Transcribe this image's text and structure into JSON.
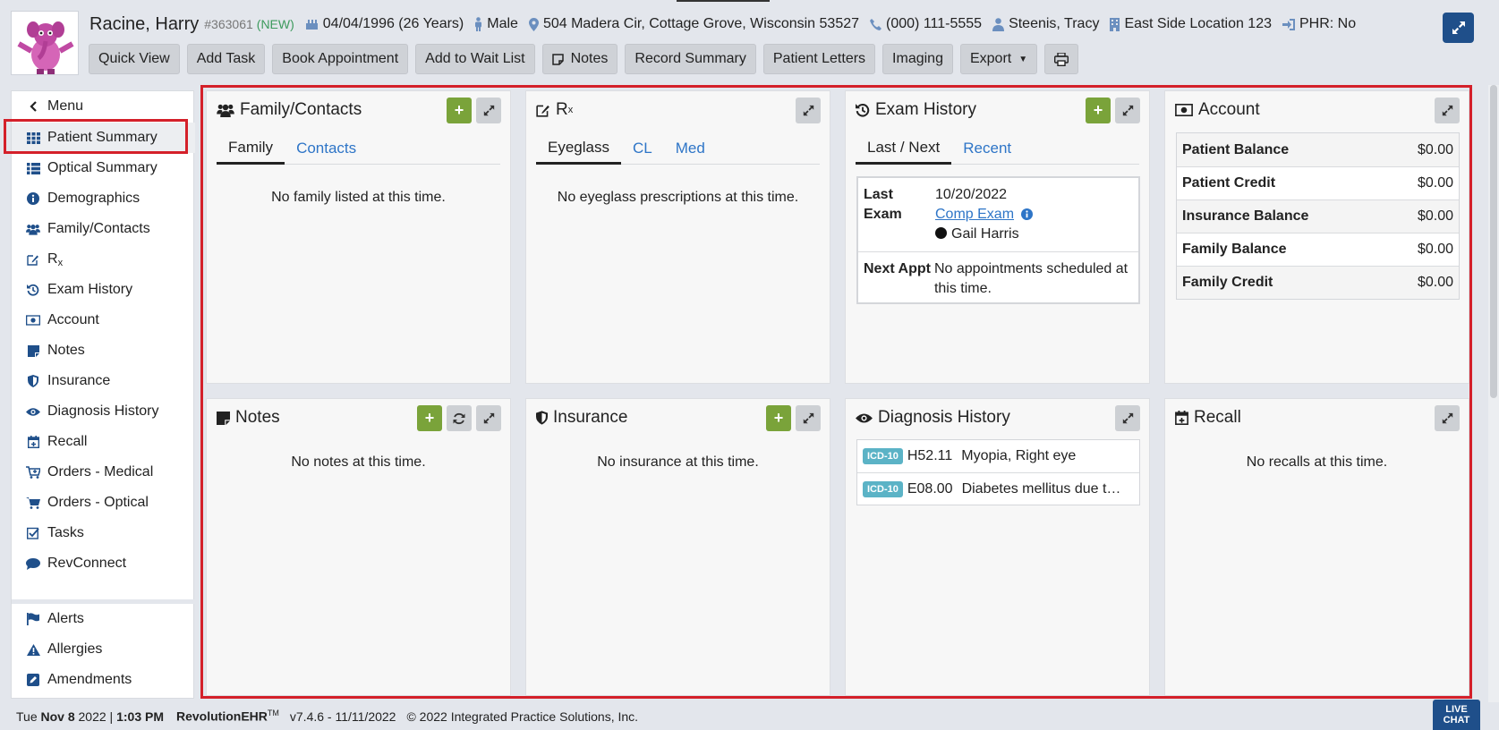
{
  "patient": {
    "name": "Racine, Harry",
    "id": "#363061",
    "status": "(NEW)",
    "dob": "04/04/1996 (26 Years)",
    "gender": "Male",
    "address": "504 Madera Cir, Cottage Grove, Wisconsin 53527",
    "phone": "(000) 111-5555",
    "provider": "Steenis, Tracy",
    "location": "East Side Location 123",
    "phr": "PHR: No"
  },
  "toolbar": {
    "quick_view": "Quick View",
    "add_task": "Add Task",
    "book_appointment": "Book Appointment",
    "add_wait_list": "Add to Wait List",
    "notes": "Notes",
    "record_summary": "Record Summary",
    "patient_letters": "Patient Letters",
    "imaging": "Imaging",
    "export": "Export"
  },
  "sidebar": {
    "menu": "Menu",
    "items": [
      {
        "label": "Patient Summary",
        "icon": "grid-icon"
      },
      {
        "label": "Optical Summary",
        "icon": "list-icon"
      },
      {
        "label": "Demographics",
        "icon": "info-icon"
      },
      {
        "label": "Family/Contacts",
        "icon": "users-icon"
      },
      {
        "label": "R",
        "sub": "x",
        "icon": "edit-icon"
      },
      {
        "label": "Exam History",
        "icon": "history-icon"
      },
      {
        "label": "Account",
        "icon": "money-icon"
      },
      {
        "label": "Notes",
        "icon": "note-icon"
      },
      {
        "label": "Insurance",
        "icon": "shield-icon"
      },
      {
        "label": "Diagnosis History",
        "icon": "eye-icon"
      },
      {
        "label": "Recall",
        "icon": "calendar-plus-icon"
      },
      {
        "label": "Orders - Medical",
        "icon": "cart-plus-icon"
      },
      {
        "label": "Orders - Optical",
        "icon": "cart-icon"
      },
      {
        "label": "Tasks",
        "icon": "check-square-icon"
      },
      {
        "label": "RevConnect",
        "icon": "chat-icon"
      }
    ],
    "bottom_items": [
      {
        "label": "Alerts",
        "icon": "flag-icon"
      },
      {
        "label": "Allergies",
        "icon": "warning-icon"
      },
      {
        "label": "Amendments",
        "icon": "pencil-square-icon"
      }
    ]
  },
  "panels": {
    "family": {
      "title": "Family/Contacts",
      "tabs": [
        "Family",
        "Contacts"
      ],
      "empty": "No family listed at this time."
    },
    "rx": {
      "title": "R",
      "title_sub": "x",
      "tabs": [
        "Eyeglass",
        "CL",
        "Med"
      ],
      "empty": "No eyeglass prescriptions at this time."
    },
    "exam": {
      "title": "Exam History",
      "tabs": [
        "Last / Next",
        "Recent"
      ],
      "last_label": "Last Exam",
      "last_date": "10/20/2022",
      "last_type": "Comp Exam",
      "last_doctor": "Gail Harris",
      "next_label": "Next Appt",
      "next_value": "No appointments scheduled at this time."
    },
    "account": {
      "title": "Account",
      "rows": [
        {
          "label": "Patient Balance",
          "value": "$0.00"
        },
        {
          "label": "Patient Credit",
          "value": "$0.00"
        },
        {
          "label": "Insurance Balance",
          "value": "$0.00"
        },
        {
          "label": "Family Balance",
          "value": "$0.00"
        },
        {
          "label": "Family Credit",
          "value": "$0.00"
        }
      ]
    },
    "notes": {
      "title": "Notes",
      "empty": "No notes at this time."
    },
    "insurance": {
      "title": "Insurance",
      "empty": "No insurance at this time."
    },
    "diagnosis": {
      "title": "Diagnosis History",
      "rows": [
        {
          "badge": "ICD-10",
          "code": "H52.11",
          "desc": "Myopia, Right eye"
        },
        {
          "badge": "ICD-10",
          "code": "E08.00",
          "desc": "Diabetes mellitus due to underlying condition"
        }
      ]
    },
    "recall": {
      "title": "Recall",
      "empty": "No recalls at this time."
    }
  },
  "footer": {
    "day": "Tue",
    "date": "Nov 8",
    "year": "2022 |",
    "time": "1:03 PM",
    "product": "RevolutionEHR",
    "tm": "TM",
    "version": "v7.4.6 - 11/11/2022",
    "copyright": "© 2022 Integrated Practice Solutions, Inc.",
    "live_chat_1": "LIVE",
    "live_chat_2": "CHAT"
  }
}
